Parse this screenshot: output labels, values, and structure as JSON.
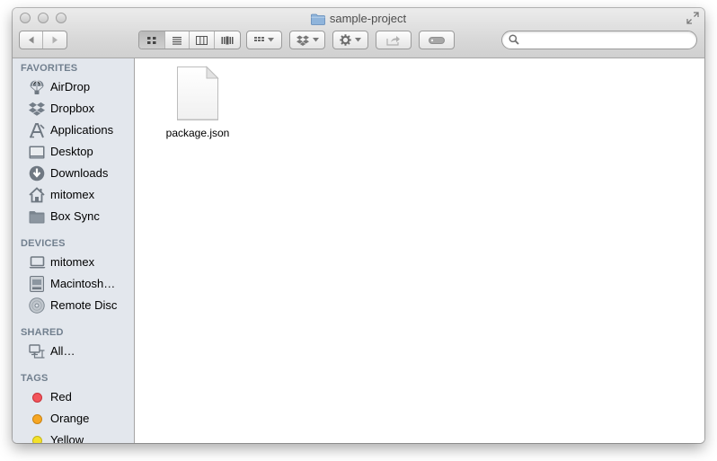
{
  "window": {
    "title": "sample-project"
  },
  "toolbar": {
    "back_icon": "chevron-left-icon",
    "forward_icon": "chevron-right-icon",
    "view_modes": [
      "icon-view",
      "list-view",
      "column-view",
      "cover-flow-view"
    ],
    "active_view": "icon-view",
    "search_placeholder": ""
  },
  "sidebar": {
    "favorites_label": "FAVORITES",
    "favorites": [
      {
        "label": "AirDrop",
        "icon": "airdrop-icon"
      },
      {
        "label": "Dropbox",
        "icon": "dropbox-icon"
      },
      {
        "label": "Applications",
        "icon": "applications-icon"
      },
      {
        "label": "Desktop",
        "icon": "desktop-icon"
      },
      {
        "label": "Downloads",
        "icon": "downloads-icon"
      },
      {
        "label": "mitomex",
        "icon": "home-icon"
      },
      {
        "label": "Box Sync",
        "icon": "folder-icon"
      }
    ],
    "devices_label": "DEVICES",
    "devices": [
      {
        "label": "mitomex",
        "icon": "laptop-icon"
      },
      {
        "label": "Macintosh…",
        "icon": "hard-drive-icon"
      },
      {
        "label": "Remote Disc",
        "icon": "disc-icon"
      }
    ],
    "shared_label": "SHARED",
    "shared": [
      {
        "label": "All…",
        "icon": "network-icon"
      }
    ],
    "tags_label": "TAGS",
    "tags": [
      {
        "label": "Red",
        "color": "#f2545b"
      },
      {
        "label": "Orange",
        "color": "#f6a623"
      },
      {
        "label": "Yellow",
        "color": "#f3e12b"
      }
    ]
  },
  "content": {
    "files": [
      {
        "name": "package.json",
        "icon": "document-icon"
      }
    ]
  }
}
